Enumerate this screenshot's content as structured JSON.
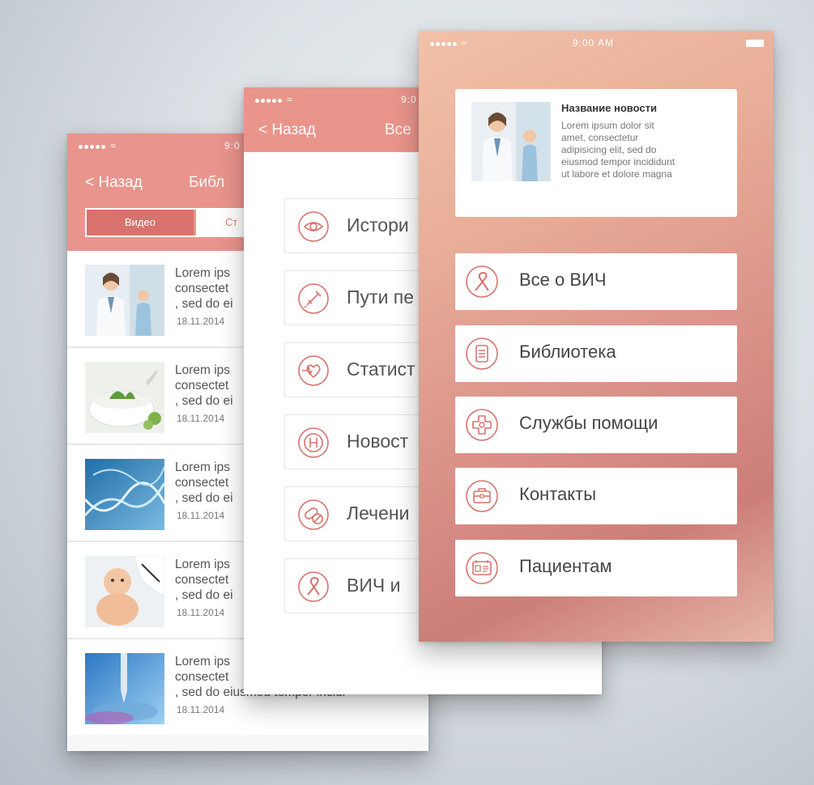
{
  "colors": {
    "header": "#e9948c",
    "accent": "#d9726c",
    "icon_stroke": "#d9726c"
  },
  "phone_list": {
    "status_time": "9:0",
    "back_label": "< Назад",
    "nav_title": "Библ",
    "tabs": {
      "active": "Видео",
      "inactive": "Ст"
    },
    "items": [
      {
        "text": "Lorem ips\nconsectet\n, sed do ei",
        "date": "18.11.2014",
        "image": "doctor-photo"
      },
      {
        "text": "Lorem ips\nconsectet\n, sed do ei",
        "date": "18.11.2014",
        "image": "herbs-mortar-photo"
      },
      {
        "text": "Lorem ips\nconsectet\n, sed do ei",
        "date": "18.11.2014",
        "image": "dna-photo"
      },
      {
        "text": "Lorem ips\nconsectet\n, sed do ei",
        "date": "18.11.2014",
        "image": "baby-photo"
      },
      {
        "text": "Lorem ips\nconsectet\n, sed do eiusmod tempor incidi-",
        "date": "18.11.2014",
        "image": "lab-pipette-photo"
      }
    ]
  },
  "phone_menu": {
    "status_time": "9:0",
    "back_label": "< Назад",
    "nav_title": "Все",
    "items": [
      {
        "label": "Истори",
        "icon": "eye-icon"
      },
      {
        "label": "Пути пе",
        "icon": "syringe-icon"
      },
      {
        "label": "Статист",
        "icon": "heartbeat-icon"
      },
      {
        "label": "Новост",
        "icon": "h-letter-icon"
      },
      {
        "label": "Лечени",
        "icon": "pills-icon"
      },
      {
        "label": "ВИЧ и",
        "icon": "ribbon-icon"
      }
    ]
  },
  "phone_home": {
    "status_time": "9:00 AM",
    "news": {
      "title": "Название новости",
      "body": "Lorem ipsum dolor sit\namet, consectetur\nadipisicing elit, sed do\neiusmod tempor incididunt\nut labore et dolore magna",
      "image": "doctor-photo"
    },
    "items": [
      {
        "label": "Все о ВИЧ",
        "icon": "ribbon-icon"
      },
      {
        "label": "Библиотека",
        "icon": "document-icon"
      },
      {
        "label": "Службы помощи",
        "icon": "medical-cross-icon"
      },
      {
        "label": "Контакты",
        "icon": "briefcase-icon"
      },
      {
        "label": "Пациентам",
        "icon": "id-card-icon"
      }
    ]
  }
}
